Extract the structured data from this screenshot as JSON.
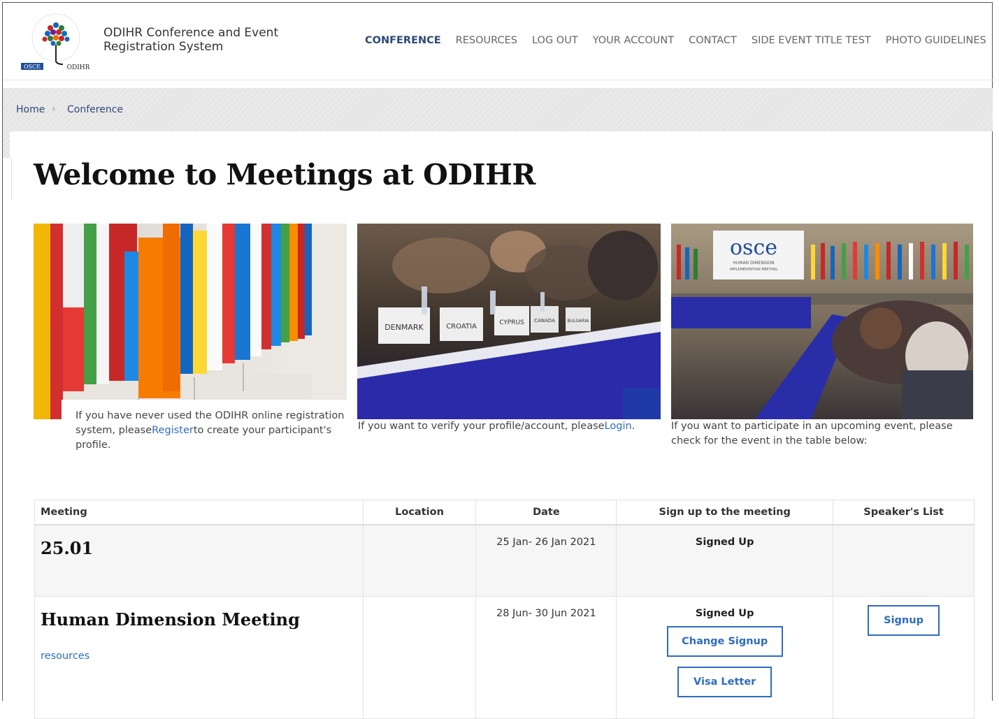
{
  "header": {
    "title_line1": "ODIHR Conference and Event",
    "title_line2": "Registration System",
    "logo_text_left": "OSCE",
    "logo_text_right": "ODIHR",
    "nav": [
      {
        "label": "CONFERENCE",
        "active": true
      },
      {
        "label": "RESOURCES"
      },
      {
        "label": "LOG OUT"
      },
      {
        "label": "YOUR ACCOUNT"
      },
      {
        "label": "CONTACT"
      },
      {
        "label": "SIDE EVENT TITLE TEST"
      },
      {
        "label": "PHOTO GUIDELINES"
      }
    ]
  },
  "breadcrumb": {
    "home": "Home",
    "separator": "›",
    "current": "Conference"
  },
  "page_title": "Welcome to Meetings at ODIHR",
  "tiles": [
    {
      "pre": "If you have never used the ODIHR online registration system, please",
      "link": "Register",
      "post": "to create your participant's profile."
    },
    {
      "pre": "If you want to verify your profile/account, please",
      "link": "Login",
      "post": "."
    },
    {
      "pre": "If you want to participate in an upcoming event, please check for the event in the table below:",
      "link": "",
      "post": ""
    }
  ],
  "tile3_sign": {
    "brand": "osce",
    "sub1": "HUMAN DIMENSION",
    "sub2": "IMPLEMENTATION MEETING"
  },
  "tile2_placards": [
    "DENMARK",
    "CROATIA",
    "CYPRUS",
    "CANADA",
    "BULGARIA"
  ],
  "table": {
    "headers": [
      "Meeting",
      "Location",
      "Date",
      "Sign up to the meeting",
      "Speaker's List"
    ],
    "rows": [
      {
        "name": "25.01",
        "location": "",
        "date": "25 Jan- 26 Jan 2021",
        "status": "Signed Up"
      },
      {
        "name": "Human Dimension Meeting",
        "link": "resources",
        "location": "",
        "date": "28 Jun- 30 Jun 2021",
        "status": "Signed Up",
        "change_btn": "Change Signup",
        "visa_btn": "Visa Letter",
        "speaker_btn": "Signup"
      }
    ]
  },
  "colors": {
    "accent": "#2d6cc0",
    "nav_active": "#2d4a77",
    "crumb_bg": "#e6e6e6"
  }
}
